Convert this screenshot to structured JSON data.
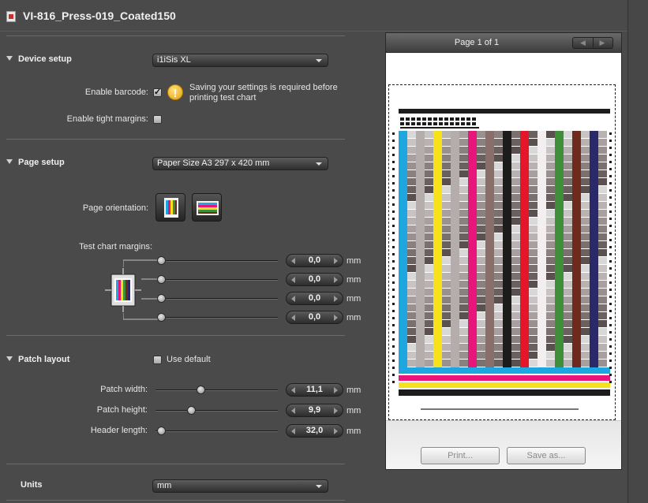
{
  "title": "VI-816_Press-019_Coated150",
  "device_setup": {
    "heading": "Device setup",
    "device_value": "i1iSis XL",
    "enable_barcode_label": "Enable barcode:",
    "enable_barcode_checked": true,
    "warning_text": "Saving your settings is required before printing test chart",
    "tight_margins_label": "Enable tight margins:",
    "tight_margins_checked": false
  },
  "page_setup": {
    "heading": "Page setup",
    "page_size_value": "Paper Size A3  297 x 420 mm",
    "orientation_label": "Page orientation:",
    "margins_label": "Test chart margins:",
    "margins": [
      {
        "value": "0,0",
        "unit": "mm"
      },
      {
        "value": "0,0",
        "unit": "mm"
      },
      {
        "value": "0,0",
        "unit": "mm"
      },
      {
        "value": "0,0",
        "unit": "mm"
      }
    ]
  },
  "patch_layout": {
    "heading": "Patch layout",
    "use_default_label": "Use default",
    "use_default_checked": false,
    "rows": [
      {
        "label": "Patch width:",
        "value": "11,1",
        "unit": "mm",
        "level": 0.33
      },
      {
        "label": "Patch height:",
        "value": "9,9",
        "unit": "mm",
        "level": 0.25
      },
      {
        "label": "Header length:",
        "value": "32,0",
        "unit": "mm",
        "level": 0.0
      }
    ]
  },
  "units": {
    "heading": "Units",
    "value": "mm"
  },
  "preview": {
    "page_label": "Page 1 of 1",
    "prev_glyph": "◀",
    "next_glyph": "▶",
    "print_label": "Print...",
    "save_label": "Save as..."
  },
  "colors": {
    "cyan": "#1ea6e0",
    "magenta": "#e8157a",
    "yellow": "#f7e21a",
    "red": "#e6162a",
    "green": "#3f8f3a",
    "brown": "#6e2a1c",
    "navy": "#2a2a6a",
    "black": "#1c1c1c",
    "warning": "#e3a20d"
  }
}
